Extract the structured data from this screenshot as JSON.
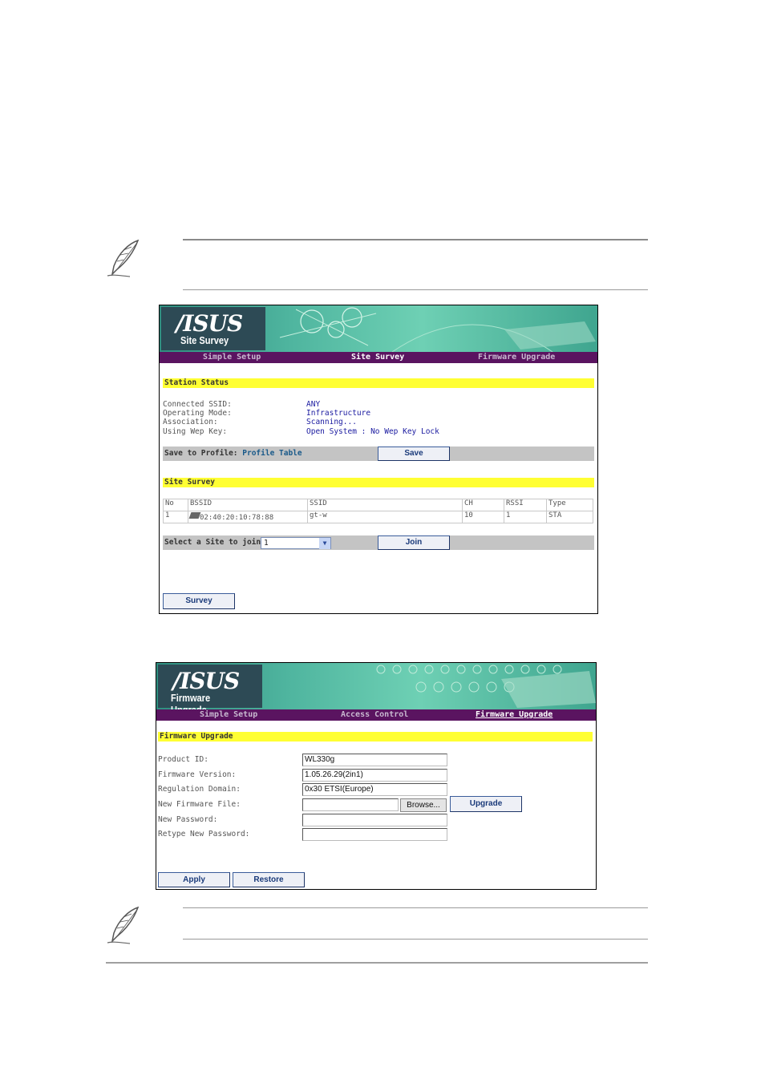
{
  "site_survey": {
    "logo": "/ISUS",
    "title": "Site Survey",
    "nav": [
      "Simple Setup",
      "Site Survey",
      "Firmware Upgrade"
    ],
    "station_status_header": "Station Status",
    "status_rows": [
      {
        "label": "Connected SSID:",
        "value": "ANY"
      },
      {
        "label": "Operating Mode:",
        "value": "Infrastructure"
      },
      {
        "label": "Association:",
        "value": "Scanning..."
      },
      {
        "label": "Using Wep Key:",
        "value": "Open System : No Wep Key Lock"
      }
    ],
    "save_to_profile_label": "Save to Profile:",
    "profile_table_link": "Profile Table",
    "save_button": "Save",
    "site_survey_header": "Site Survey",
    "table": {
      "headers": [
        "No",
        "BSSID",
        "SSID",
        "CH",
        "RSSI",
        "Type"
      ],
      "rows": [
        [
          "1",
          "02:40:20:10:78:88",
          "gt-w",
          "10",
          "1",
          "STA"
        ]
      ]
    },
    "select_label": "Select a Site to join:",
    "select_value": "1",
    "join_button": "Join",
    "survey_button": "Survey"
  },
  "firmware_upgrade": {
    "logo": "/ISUS",
    "title": "Firmware Upgrade",
    "nav": [
      "Simple Setup",
      "Access Control",
      "Firmware Upgrade"
    ],
    "header": "Firmware Upgrade",
    "fields": [
      {
        "label": "Product ID:",
        "value": "WL330g"
      },
      {
        "label": "Firmware Version:",
        "value": "1.05.26.29(2in1)"
      },
      {
        "label": "Regulation Domain:",
        "value": "0x30 ETSI(Europe)"
      },
      {
        "label": "New Firmware File:",
        "value": ""
      },
      {
        "label": "New Password:",
        "value": ""
      },
      {
        "label": "Retype New Password:",
        "value": ""
      }
    ],
    "browse_button": "Browse...",
    "upgrade_button": "Upgrade",
    "apply_button": "Apply",
    "restore_button": "Restore"
  },
  "colors": {
    "nav_bg": "#5a1460",
    "header_bar": "#ffff33",
    "gray_bar": "#c4c4c4",
    "value_text": "#1a1aa0"
  }
}
